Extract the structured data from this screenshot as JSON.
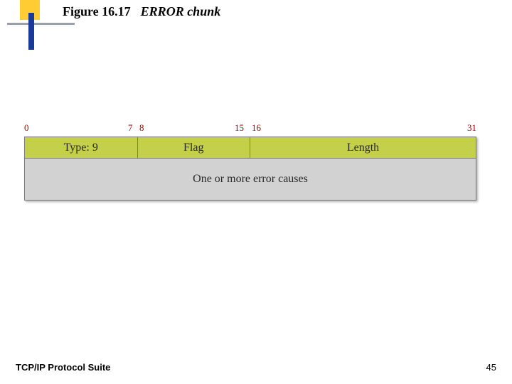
{
  "header": {
    "figure_number": "Figure 16.17",
    "figure_caption": "ERROR chunk"
  },
  "bit_offsets": {
    "b0": "0",
    "b7": "7",
    "b8": "8",
    "b15": "15",
    "b16": "16",
    "b31": "31"
  },
  "fields": {
    "type": "Type: 9",
    "flag": "Flag",
    "length": "Length",
    "body": "One or more error causes"
  },
  "footer": {
    "left": "TCP/IP Protocol Suite",
    "page": "45"
  },
  "chart_data": {
    "type": "table",
    "title": "ERROR chunk",
    "bit_width": 32,
    "rows": [
      {
        "cells": [
          {
            "label": "Type: 9",
            "bits_start": 0,
            "bits_end": 7
          },
          {
            "label": "Flag",
            "bits_start": 8,
            "bits_end": 15
          },
          {
            "label": "Length",
            "bits_start": 16,
            "bits_end": 31
          }
        ]
      },
      {
        "cells": [
          {
            "label": "One or more error causes",
            "bits_start": 0,
            "bits_end": 31
          }
        ]
      }
    ]
  }
}
